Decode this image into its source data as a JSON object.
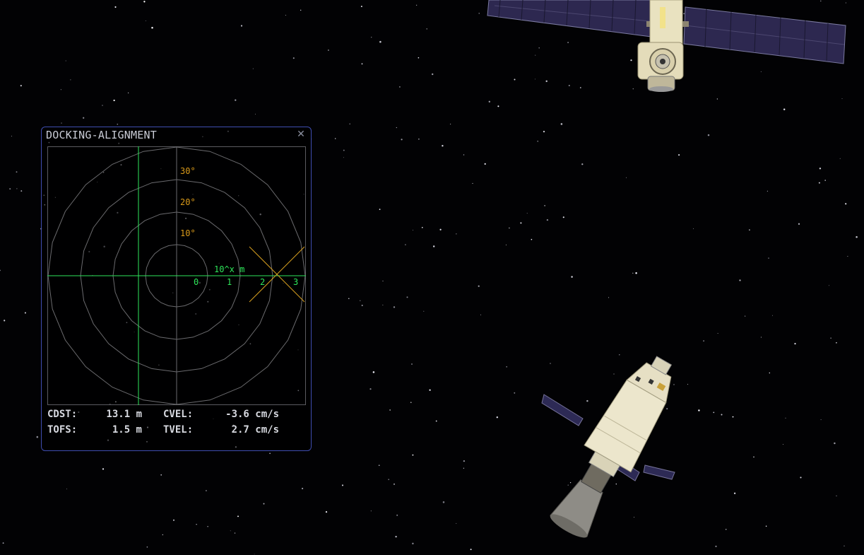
{
  "window": {
    "title": "DOCKING-ALIGNMENT",
    "close_icon": "close-icon"
  },
  "radar": {
    "angle_labels": [
      "10°",
      "20°",
      "30°"
    ],
    "distance_scale_label": "10^x m",
    "distance_ticks": [
      "0",
      "1",
      "2",
      "3"
    ],
    "colors": {
      "grid": "#6a6a6e",
      "axis_green": "#2ee65a",
      "angle_label": "#d99a1a",
      "target_marker": "#d9a020"
    }
  },
  "readouts": {
    "cdst_label": "CDST:",
    "cdst_value": "13.1 m",
    "cvel_label": "CVEL:",
    "cvel_value": "-3.6 cm/s",
    "tofs_label": "TOFS:",
    "tofs_value": "1.5 m",
    "tvel_label": "TVEL:",
    "tvel_value": "2.7 cm/s"
  }
}
